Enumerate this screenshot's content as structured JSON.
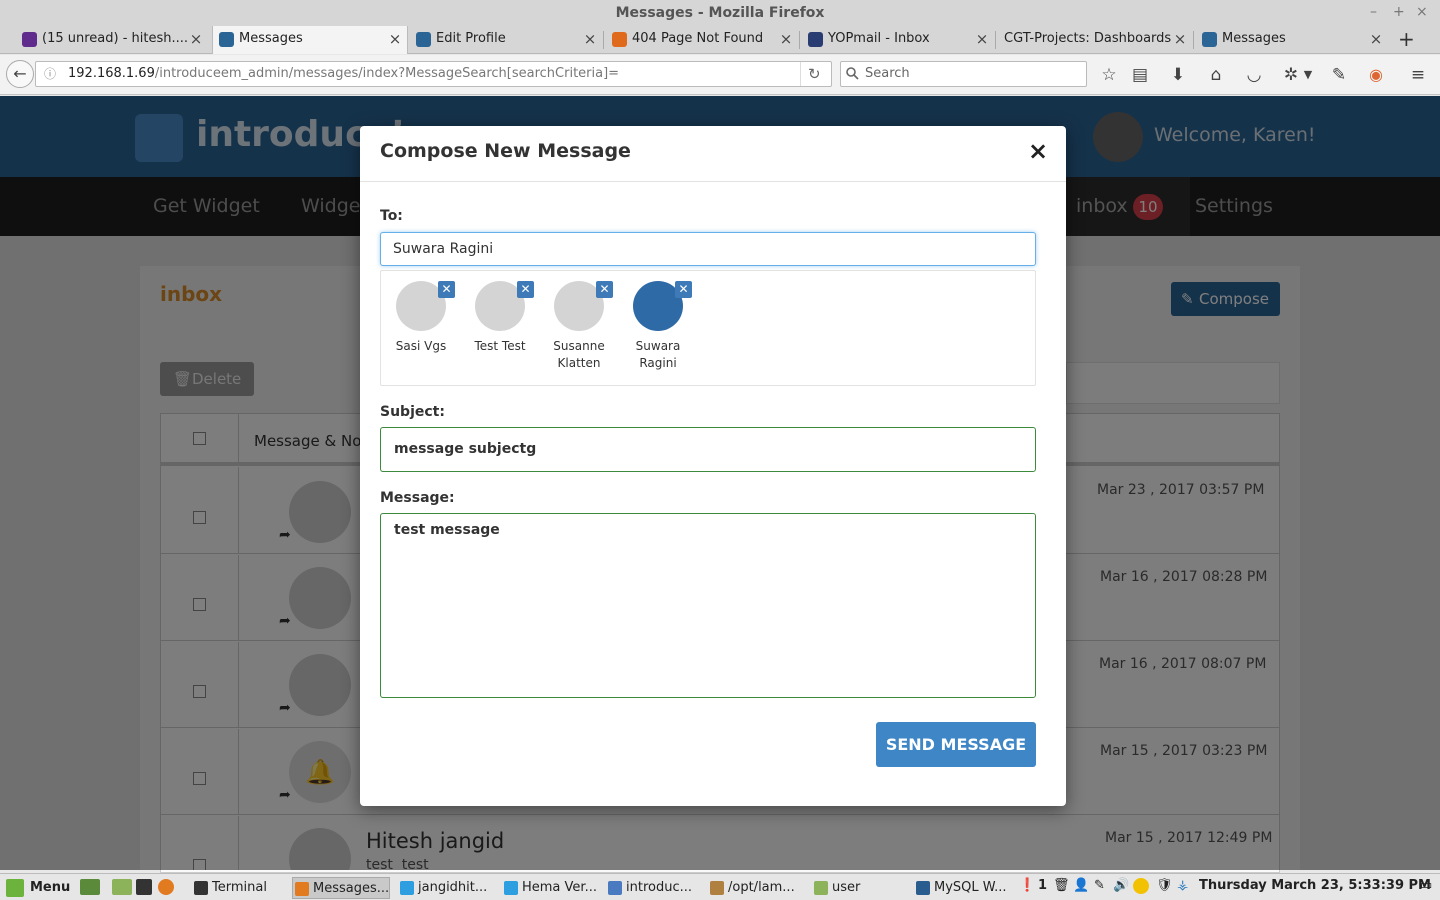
{
  "window": {
    "title": "Messages - Mozilla Firefox"
  },
  "tabs": [
    {
      "label": "(15 unread) - hitesh....",
      "color": "#5f2b8c"
    },
    {
      "label": "Messages",
      "color": "#2b6596"
    },
    {
      "label": "Edit Profile",
      "color": "#2b6596"
    },
    {
      "label": "404 Page Not Found",
      "color": "#e06a1b"
    },
    {
      "label": "YOPmail - Inbox",
      "color": "#2a3d73"
    },
    {
      "label": "CGT-Projects: Dashboards",
      "color": ""
    },
    {
      "label": "Messages",
      "color": "#2b6596"
    }
  ],
  "navbar": {
    "url_host": "192.168.1.69",
    "url_path": "/introduceem_admin/messages/index?MessageSearch[searchCriteria]=",
    "search_placeholder": "Search"
  },
  "site": {
    "brand": "introduce’",
    "welcome": "Welcome, Karen!",
    "nav": [
      "Get Widget",
      "Widge",
      "inbox",
      "Settings"
    ],
    "inbox_badge": "10"
  },
  "page": {
    "heading": "inbox",
    "compose_label": "Compose",
    "delete_label": "Delete",
    "column_header": "Message & No",
    "rows": [
      {
        "date": "Mar 23 , 2017 03:57 PM",
        "name": "",
        "preview": ""
      },
      {
        "date": "Mar 16 , 2017 08:28 PM",
        "name": "",
        "preview": ""
      },
      {
        "date": "Mar 16 , 2017 08:07 PM",
        "name": "",
        "preview": ""
      },
      {
        "date": "Mar 15 , 2017 03:23 PM",
        "name": "",
        "preview": ""
      },
      {
        "date": "Mar 15 , 2017 12:49 PM",
        "name": "Hitesh jangid",
        "preview": "test  test"
      }
    ]
  },
  "modal": {
    "title": "Compose New Message",
    "to_label": "To:",
    "to_value": "Suwara Ragini",
    "recipients": [
      {
        "name": "Sasi Vgs"
      },
      {
        "name": "Test Test"
      },
      {
        "name": "Susanne Klatten"
      },
      {
        "name": "Suwara Ragini"
      }
    ],
    "subject_label": "Subject:",
    "subject_value": "message subjectg",
    "message_label": "Message:",
    "message_value": "test message",
    "send_label": "SEND MESSAGE"
  },
  "taskbar": {
    "menu_label": "Menu",
    "items": [
      {
        "label": "Terminal"
      },
      {
        "label": "Messages..."
      },
      {
        "label": "jangidhit..."
      },
      {
        "label": "Hema Ver..."
      },
      {
        "label": "introduc..."
      },
      {
        "label": "/opt/lam..."
      },
      {
        "label": "user"
      },
      {
        "label": "MySQL W..."
      }
    ],
    "notification_count": "1",
    "clock": "Thursday March 23,  5:33:39 PM"
  },
  "colors": {
    "brand_blue": "#2b6596",
    "primary_button": "#3e86c5",
    "valid_green": "#3c8a3c",
    "badge_red": "#d9414a",
    "orange_heading": "#d98a2b"
  }
}
